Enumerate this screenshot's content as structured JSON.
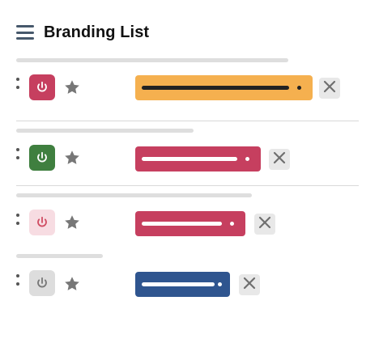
{
  "header": {
    "title": "Branding List",
    "menu_icon": "hamburger-menu-icon"
  },
  "colors": {
    "menu_icon": "#46586b",
    "skeleton": "#dedede",
    "divider": "#d9d9d9",
    "star": "#777777",
    "drag_handle": "#555555",
    "remove_bg": "#e8e8e8",
    "remove_icon": "#6f6f6f"
  },
  "rows": [
    {
      "toggle": {
        "state": "on",
        "bg": "#c63f5f",
        "icon_color": "#ffffff",
        "icon": "power-icon"
      },
      "brand": {
        "bg": "#f5b04f",
        "line": "#222222",
        "dot": "#222222"
      },
      "star_icon": "star-icon",
      "remove_icon": "close-icon"
    },
    {
      "toggle": {
        "state": "on",
        "bg": "#3f7f3f",
        "icon_color": "#ffffff",
        "icon": "power-icon"
      },
      "brand": {
        "bg": "#c63f5f",
        "line": "#ffffff",
        "dot": "#ffffff"
      },
      "star_icon": "star-icon",
      "remove_icon": "close-icon"
    },
    {
      "toggle": {
        "state": "off",
        "bg": "#f7dce2",
        "icon_color": "#d04d63",
        "icon": "power-icon"
      },
      "brand": {
        "bg": "#c63f5f",
        "line": "#ffffff",
        "dot": "#ffffff"
      },
      "star_icon": "star-icon",
      "remove_icon": "close-icon"
    },
    {
      "toggle": {
        "state": "off",
        "bg": "#dddddd",
        "icon_color": "#777777",
        "icon": "power-icon"
      },
      "brand": {
        "bg": "#2f558f",
        "line": "#ffffff",
        "dot": "#ffffff"
      },
      "star_icon": "star-icon",
      "remove_icon": "close-icon"
    }
  ]
}
